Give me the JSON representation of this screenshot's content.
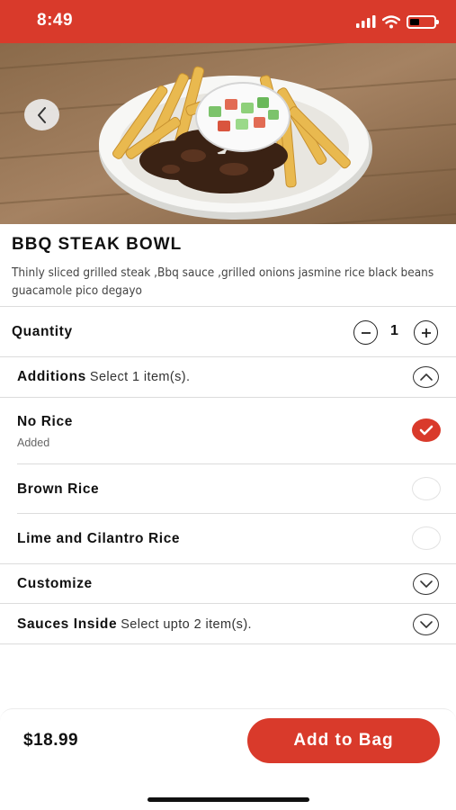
{
  "status_bar": {
    "time": "8:49",
    "icons": [
      "signal-icon",
      "wifi-icon",
      "battery-icon"
    ],
    "color": "#d93a2b"
  },
  "hero": {
    "image": "bbq-steak-bowl-photo",
    "back_icon": "chevron-left-icon"
  },
  "product": {
    "title": "BBQ STEAK BOWL",
    "description": "Thinly sliced grilled steak ,Bbq sauce ,grilled onions jasmine rice black beans guacamole pico degayo"
  },
  "quantity": {
    "label": "Quantity",
    "value": "1",
    "decrease_icon": "minus-icon",
    "increase_icon": "plus-icon"
  },
  "additions": {
    "label": "Additions",
    "sub": "Select 1 item(s).",
    "expanded": true,
    "items": [
      {
        "label": "No Rice",
        "status": "Added",
        "selected": true
      },
      {
        "label": "Brown Rice",
        "selected": false
      },
      {
        "label": "Lime and Cilantro Rice",
        "selected": false
      }
    ]
  },
  "customize": {
    "label": "Customize",
    "expanded": false
  },
  "sauces": {
    "label": "Sauces Inside",
    "sub": "Select upto 2 item(s).",
    "expanded": false
  },
  "footer": {
    "price": "$18.99",
    "add_button": "Add to Bag"
  },
  "colors": {
    "accent": "#d93a2b",
    "text": "#111111",
    "divider": "#dcdcdc"
  }
}
